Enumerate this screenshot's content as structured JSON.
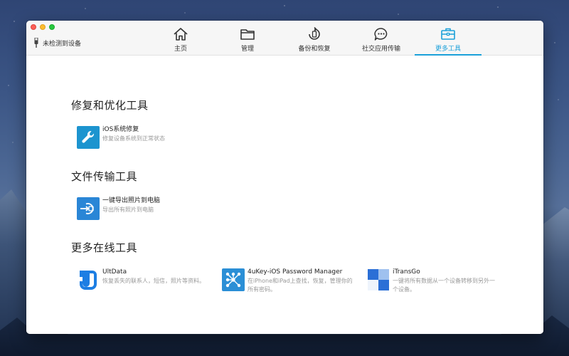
{
  "window": {
    "device_status": "未检测到设备",
    "tabs": [
      {
        "label": "主页",
        "icon": "home-icon",
        "active": false
      },
      {
        "label": "管理",
        "icon": "folder-icon",
        "active": false
      },
      {
        "label": "备份和恢复",
        "icon": "backup-restore-icon",
        "active": false
      },
      {
        "label": "社交应用传输",
        "icon": "chat-bubble-icon",
        "active": false
      },
      {
        "label": "更多工具",
        "icon": "toolbox-icon",
        "active": true
      }
    ],
    "accent_color": "#1aa0d9"
  },
  "sections": [
    {
      "title": "修复和优化工具",
      "items": [
        {
          "name": "iOS系统修复",
          "desc": "修复设备系统到正常状态",
          "icon": "wrench-icon",
          "icon_color": "#1c94cf"
        }
      ]
    },
    {
      "title": "文件传输工具",
      "items": [
        {
          "name": "一键导出照片到电脑",
          "desc": "导出所有照片到电脑",
          "icon": "export-to-pc-icon",
          "icon_color": "#2a86d6"
        }
      ]
    },
    {
      "title": "更多在线工具",
      "items": [
        {
          "name": "UltData",
          "desc": "恢复丢失的联系人，短信，照片等资料。",
          "icon": "ultdata-logo-icon",
          "icon_color": "#1d7ee3"
        },
        {
          "name": "4uKey-iOS Password Manager",
          "desc": "在iPhone和iPad上查找，恢复，管理你的所有密码。",
          "icon": "4ukey-logo-icon",
          "icon_color": "#2b8fd6"
        },
        {
          "name": "iTransGo",
          "desc": "一键将所有数据从一个设备转移到另外一个设备。",
          "icon": "itransgo-logo-icon",
          "icon_color": "#2b6fd6"
        }
      ]
    }
  ]
}
